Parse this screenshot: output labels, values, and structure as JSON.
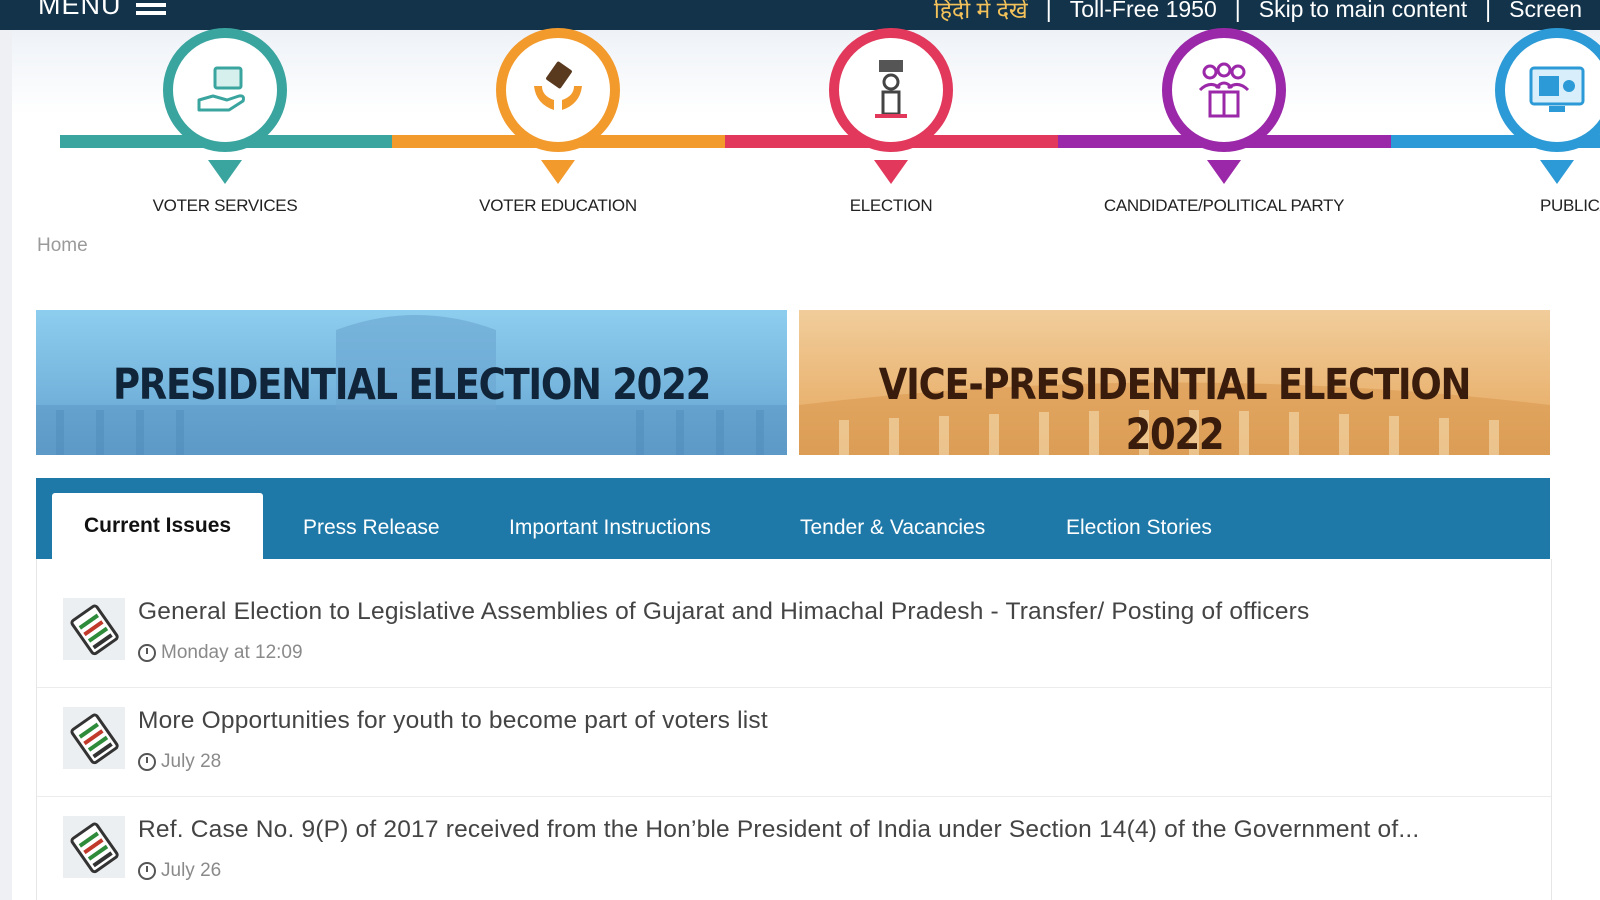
{
  "topbar": {
    "menu_label": "MENU",
    "links": {
      "hindi": "हिंदी में देखें",
      "toll_free": "Toll-Free 1950",
      "skip": "Skip to main content",
      "screen": "Screen"
    },
    "separator": "|"
  },
  "nav": {
    "items": [
      {
        "label": "VOTER SERVICES",
        "color": "#3aa59f",
        "icon": "hand-with-card-icon"
      },
      {
        "label": "VOTER EDUCATION",
        "color": "#f39a2c",
        "icon": "hands-ballot-icon"
      },
      {
        "label": "ELECTION",
        "color": "#e2385b",
        "icon": "ballot-box-icon"
      },
      {
        "label": "CANDIDATE/POLITICAL PARTY",
        "color": "#9b28a8",
        "icon": "candidates-podium-icon"
      },
      {
        "label": "PUBLICA",
        "color": "#2b9ad6",
        "icon": "publication-monitor-icon"
      }
    ]
  },
  "breadcrumb": {
    "home": "Home"
  },
  "banners": {
    "presidential": "PRESIDENTIAL ELECTION 2022",
    "vice_presidential": "VICE-PRESIDENTIAL ELECTION 2022"
  },
  "tabs": [
    {
      "label": "Current Issues",
      "active": true
    },
    {
      "label": "Press Release"
    },
    {
      "label": "Important Instructions"
    },
    {
      "label": "Tender & Vacancies"
    },
    {
      "label": "Election Stories"
    }
  ],
  "items": [
    {
      "title": "General Election to Legislative Assemblies of Gujarat and Himachal Pradesh - Transfer/ Posting of officers",
      "date": "Monday at 12:09"
    },
    {
      "title": "More Opportunities for youth to become part of voters list",
      "date": "July 28"
    },
    {
      "title": "Ref. Case No. 9(P) of 2017 received from the Hon’ble President of India under Section 14(4) of the Government of...",
      "date": "July 26"
    }
  ],
  "colors": {
    "topbar": "#13334a",
    "tabs_bar": "#1f79a8",
    "hindi_link": "#f4c25a"
  }
}
